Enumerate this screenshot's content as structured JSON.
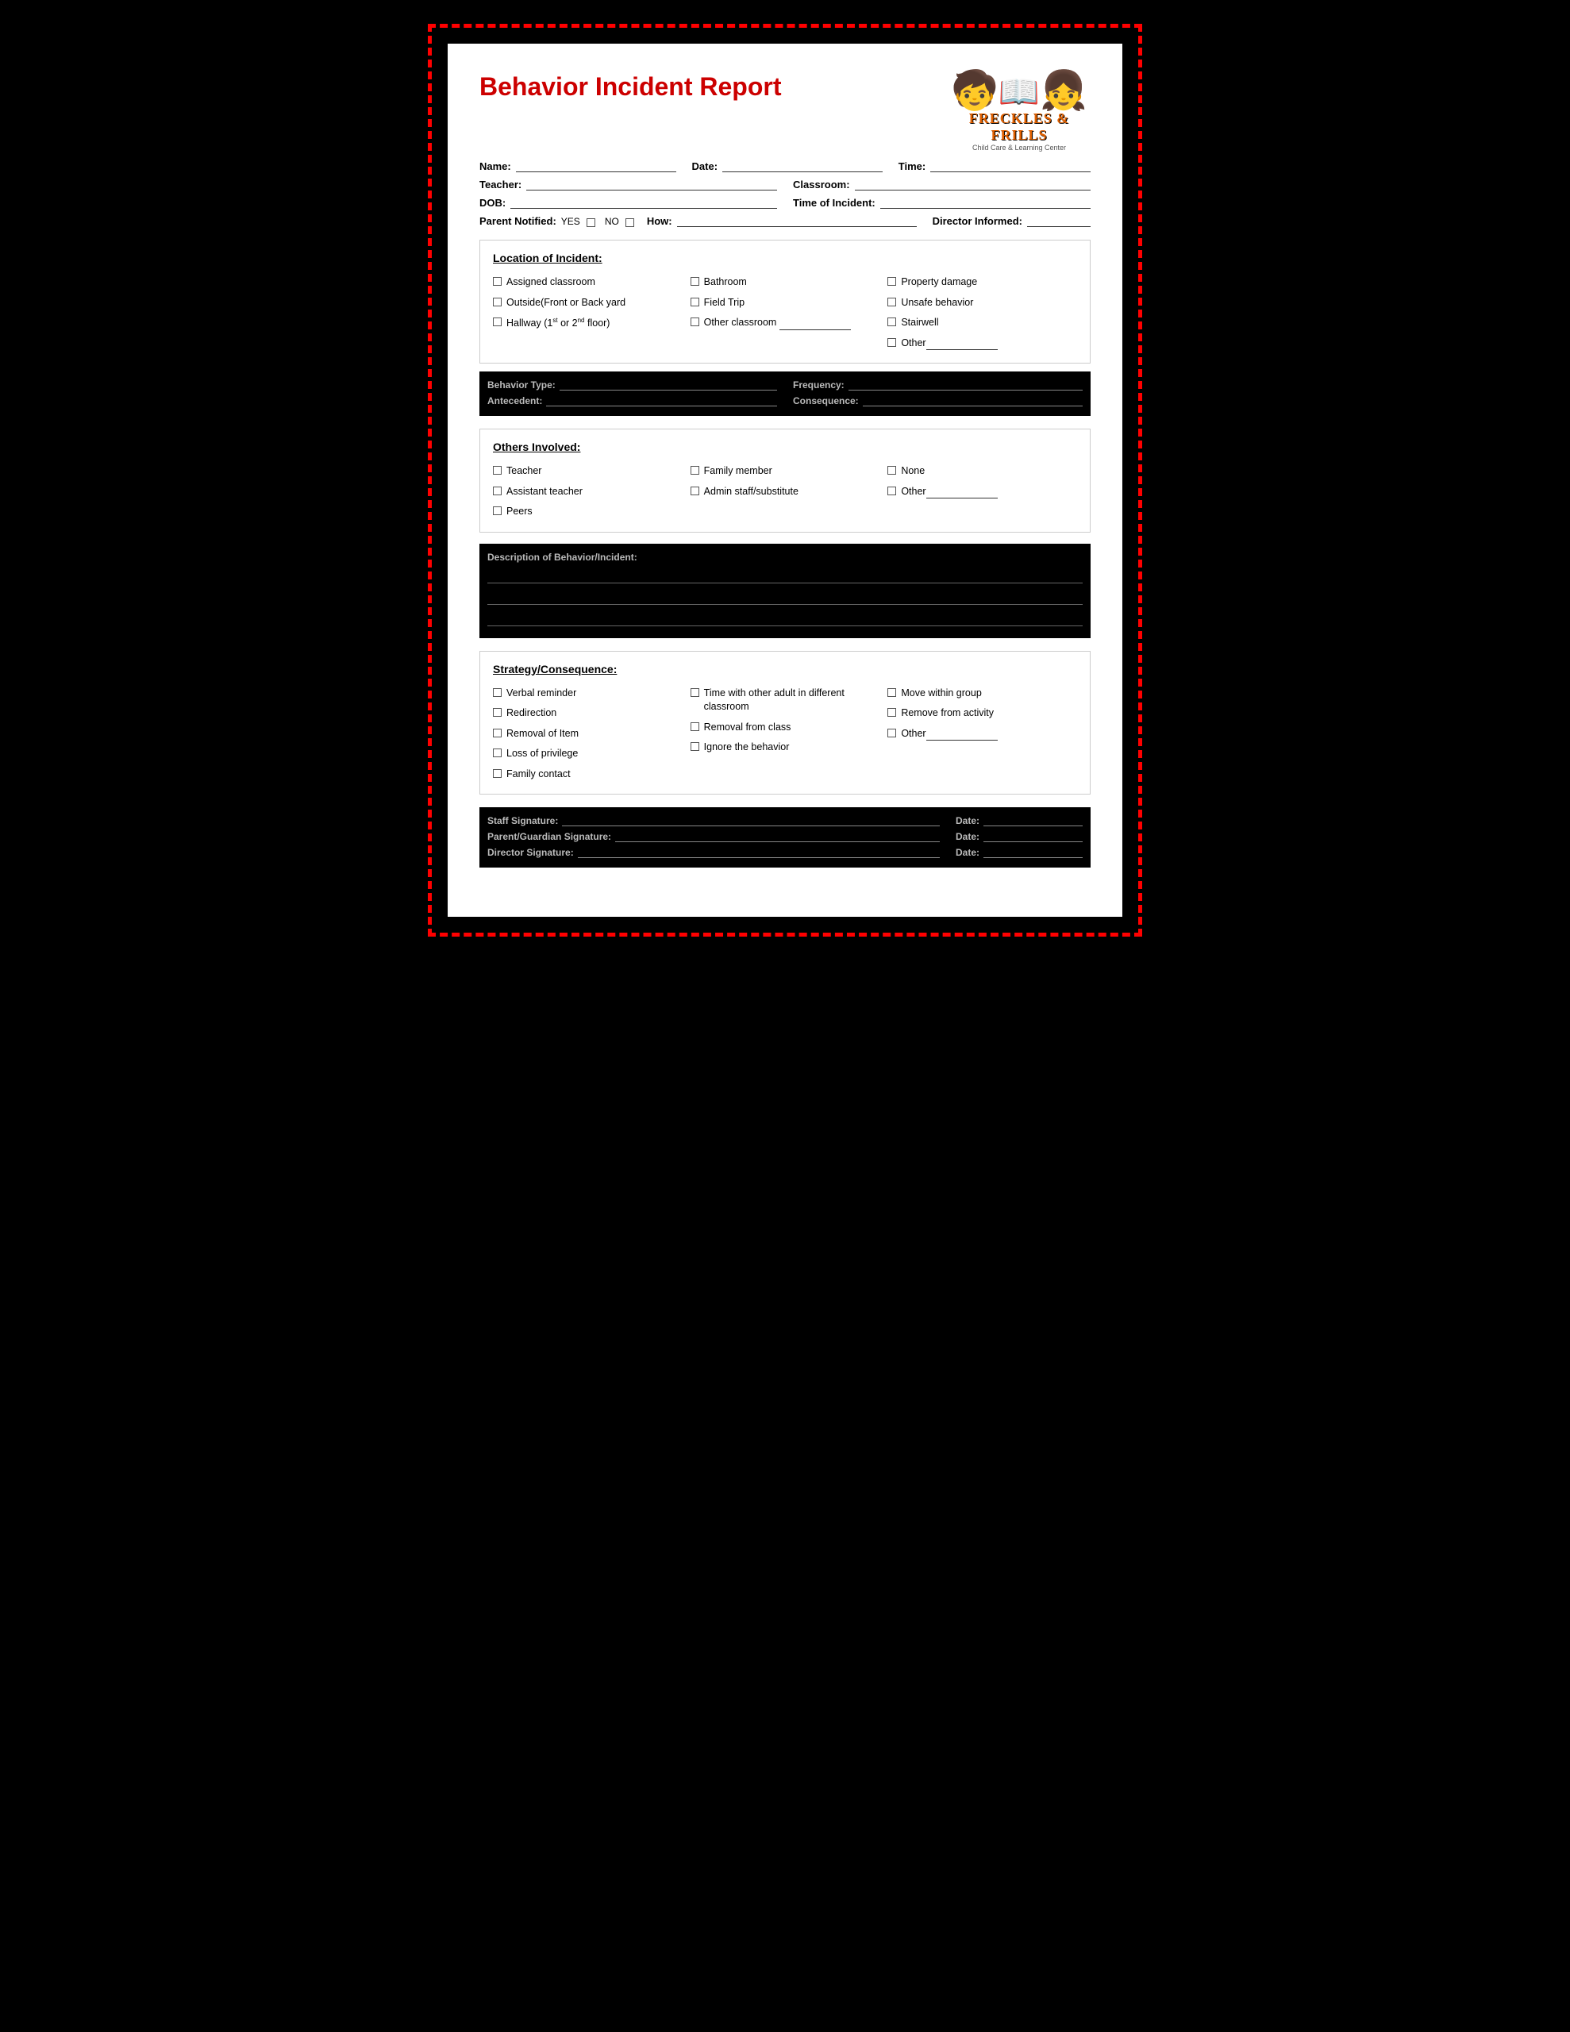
{
  "title": "Behavior Incident Report",
  "logo": {
    "decoration": "🧒📚👧",
    "brand_name": "FRECKLES & FRILLS",
    "brand_sub": "Child Care & Learning Center"
  },
  "form_fields": {
    "name_label": "Name:",
    "date_label": "Date:",
    "time_label": "Time:",
    "teacher_label": "Teacher:",
    "classroom_label": "Classroom:",
    "dob_label": "DOB:",
    "incident_time_label": "Time of Incident:",
    "parent_notified_label": "Parent Notified:",
    "how_label": "How:",
    "director_label": "Director Informed:",
    "yes_label": "YES",
    "no_label": "NO"
  },
  "location_section": {
    "title": "Location of Incident:",
    "col1": [
      "Assigned classroom",
      "Outside(Front or Back yard",
      "Hallway (1st or 2nd floor)"
    ],
    "col2": [
      "Bathroom",
      "Field Trip",
      "Other classroom"
    ],
    "col3": [
      "Property damage",
      "Unsafe behavior",
      "Stairwell",
      "Other"
    ]
  },
  "others_section": {
    "title": "Others Involved:",
    "col1": [
      "Teacher",
      "Assistant teacher",
      "Peers"
    ],
    "col2": [
      "Family member",
      "Admin staff/substitute"
    ],
    "col3": [
      "None",
      "Other"
    ]
  },
  "strategy_section": {
    "title": "Strategy/Consequence:",
    "col1": [
      "Verbal reminder",
      "Redirection",
      "Removal of Item",
      "Loss of privilege",
      "Family contact"
    ],
    "col2": [
      "Time with other adult in different classroom",
      "Removal from class",
      "Ignore the behavior"
    ],
    "col3": [
      "Move within group",
      "Remove from activity",
      "Other"
    ]
  },
  "narrative_section": {
    "label": "Description of Behavior/Incident:"
  },
  "bottom_fields": {
    "staff_signature_label": "Staff Signature:",
    "date_label": "Date:",
    "parent_signature_label": "Parent/Guardian Signature:",
    "date2_label": "Date:",
    "director_signature_label": "Director Signature:",
    "date3_label": "Date:"
  }
}
